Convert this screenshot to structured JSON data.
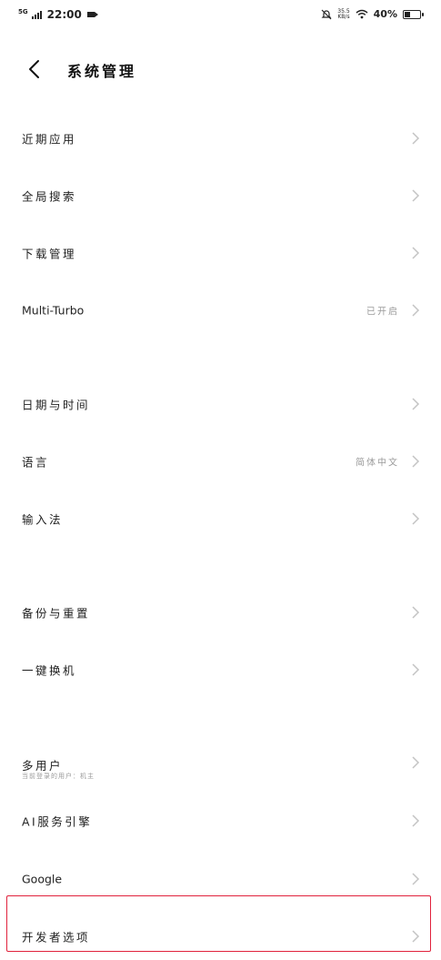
{
  "status_bar": {
    "network": "5G",
    "time": "22:00",
    "speed_value": "35.5",
    "speed_unit": "KB/s",
    "battery_pct": "40%",
    "battery_level": 0.4
  },
  "header": {
    "title": "系统管理"
  },
  "items": [
    {
      "label": "近期应用"
    },
    {
      "label": "全局搜索"
    },
    {
      "label": "下载管理"
    },
    {
      "label": "Multi-Turbo",
      "value": "已开启"
    },
    {
      "label": "日期与时间"
    },
    {
      "label": "语言",
      "value": "简体中文"
    },
    {
      "label": "输入法"
    },
    {
      "label": "备份与重置"
    },
    {
      "label": "一键换机"
    },
    {
      "label": "多用户",
      "sub": "当前登录的用户：机主"
    },
    {
      "label": "AI服务引擎"
    },
    {
      "label": "Google"
    },
    {
      "label": "开发者选项"
    }
  ],
  "colors": {
    "highlight": "#e0223c",
    "secondary_text": "#9a9a9a"
  },
  "icons": {
    "back": "back-arrow-icon",
    "chevron": "chevron-right-icon"
  }
}
